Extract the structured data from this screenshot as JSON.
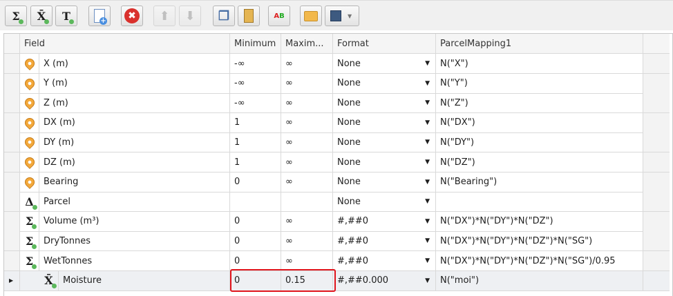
{
  "toolbar": {
    "buttons": [
      "sum-field",
      "mean-field",
      "text-field",
      "add",
      "delete",
      "move-up",
      "move-down",
      "copy",
      "paste",
      "rename",
      "open",
      "save"
    ]
  },
  "columns": {
    "field": "Field",
    "minimum": "Minimum",
    "maximum": "Maxim...",
    "format": "Format",
    "mapping": "ParcelMapping1"
  },
  "rows": [
    {
      "icon": "pin",
      "field": "X (m)",
      "min": "-∞",
      "max": "∞",
      "format": "None",
      "mapping": "N(\"X\")"
    },
    {
      "icon": "pin",
      "field": "Y (m)",
      "min": "-∞",
      "max": "∞",
      "format": "None",
      "mapping": "N(\"Y\")"
    },
    {
      "icon": "pin",
      "field": "Z (m)",
      "min": "-∞",
      "max": "∞",
      "format": "None",
      "mapping": "N(\"Z\")"
    },
    {
      "icon": "pin",
      "field": "DX (m)",
      "min": "1",
      "max": "∞",
      "format": "None",
      "mapping": "N(\"DX\")"
    },
    {
      "icon": "pin",
      "field": "DY (m)",
      "min": "1",
      "max": "∞",
      "format": "None",
      "mapping": "N(\"DY\")"
    },
    {
      "icon": "pin",
      "field": "DZ (m)",
      "min": "1",
      "max": "∞",
      "format": "None",
      "mapping": "N(\"DZ\")"
    },
    {
      "icon": "pin",
      "field": "Bearing",
      "min": "0",
      "max": "∞",
      "format": "None",
      "mapping": "N(\"Bearing\")"
    },
    {
      "icon": "Δ",
      "field": "Parcel",
      "min": "",
      "max": "",
      "format": "None",
      "mapping": ""
    },
    {
      "icon": "Σ",
      "field": "Volume (m³)",
      "min": "0",
      "max": "∞",
      "format": "#,##0",
      "mapping": "N(\"DX\")*N(\"DY\")*N(\"DZ\")"
    },
    {
      "icon": "Σ",
      "field": "DryTonnes",
      "min": "0",
      "max": "∞",
      "format": "#,##0",
      "mapping": "N(\"DX\")*N(\"DY\")*N(\"DZ\")*N(\"SG\")"
    },
    {
      "icon": "Σ",
      "field": "WetTonnes",
      "min": "0",
      "max": "∞",
      "format": "#,##0",
      "mapping": "N(\"DX\")*N(\"DY\")*N(\"DZ\")*N(\"SG\")/0.95"
    },
    {
      "icon": "X̄",
      "field": "Moisture",
      "min": "0",
      "max": "0.15",
      "format": "#,##0.000",
      "mapping": "N(\"moi\")"
    }
  ],
  "highlight_color": "#e0141c"
}
